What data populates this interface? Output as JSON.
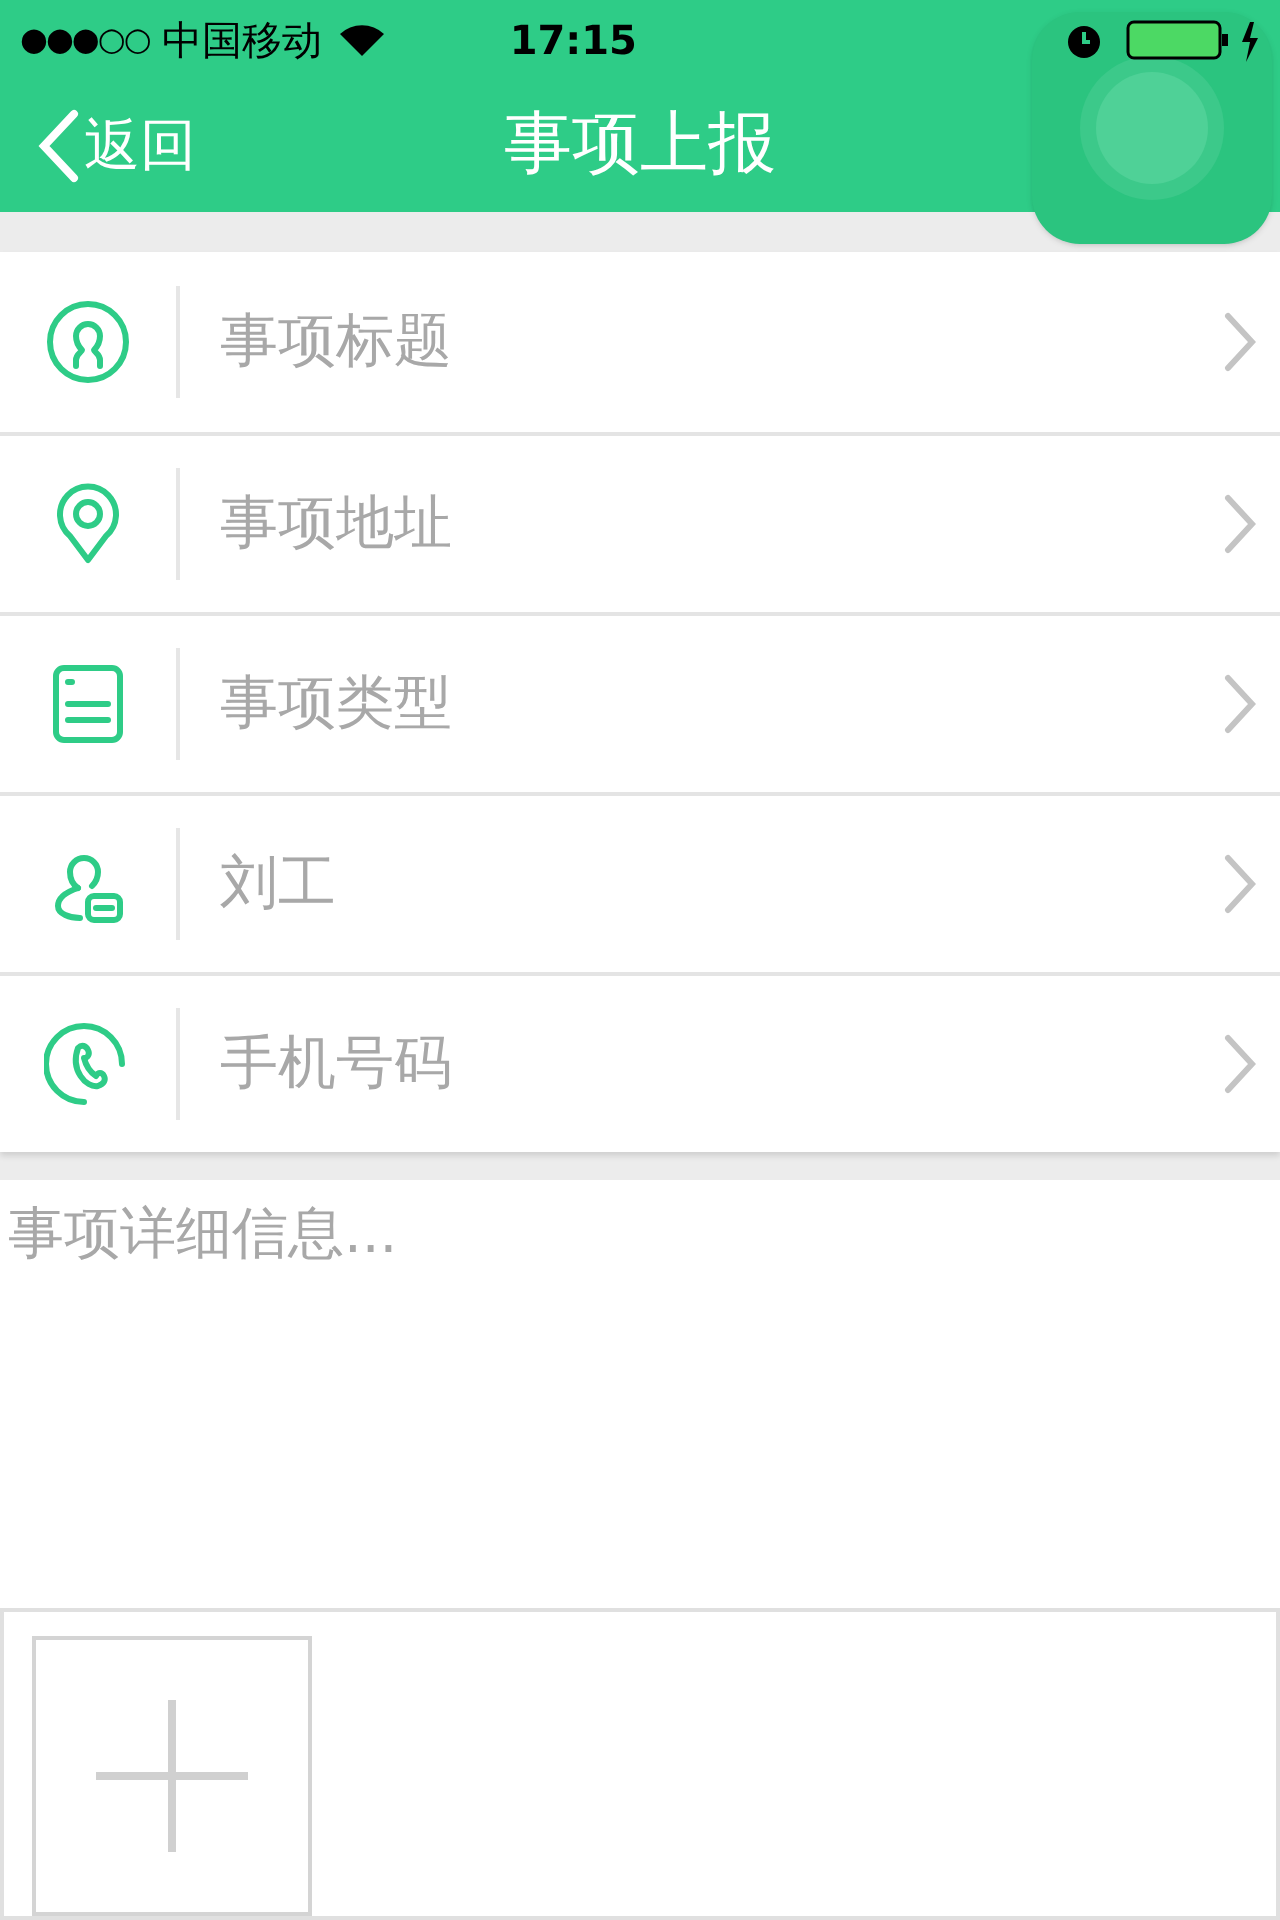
{
  "status_bar": {
    "signal": "●●●○○",
    "carrier": "中国移动",
    "time": "17:15"
  },
  "nav": {
    "back": "返回",
    "title": "事项上报"
  },
  "fields": [
    {
      "kind": "person",
      "placeholder": "事项标题"
    },
    {
      "kind": "pin",
      "placeholder": "事项地址"
    },
    {
      "kind": "document",
      "placeholder": "事项类型"
    },
    {
      "kind": "contact",
      "placeholder": "刘工"
    },
    {
      "kind": "phone",
      "placeholder": "手机号码"
    }
  ],
  "details": {
    "placeholder": "事项详细信息..."
  }
}
